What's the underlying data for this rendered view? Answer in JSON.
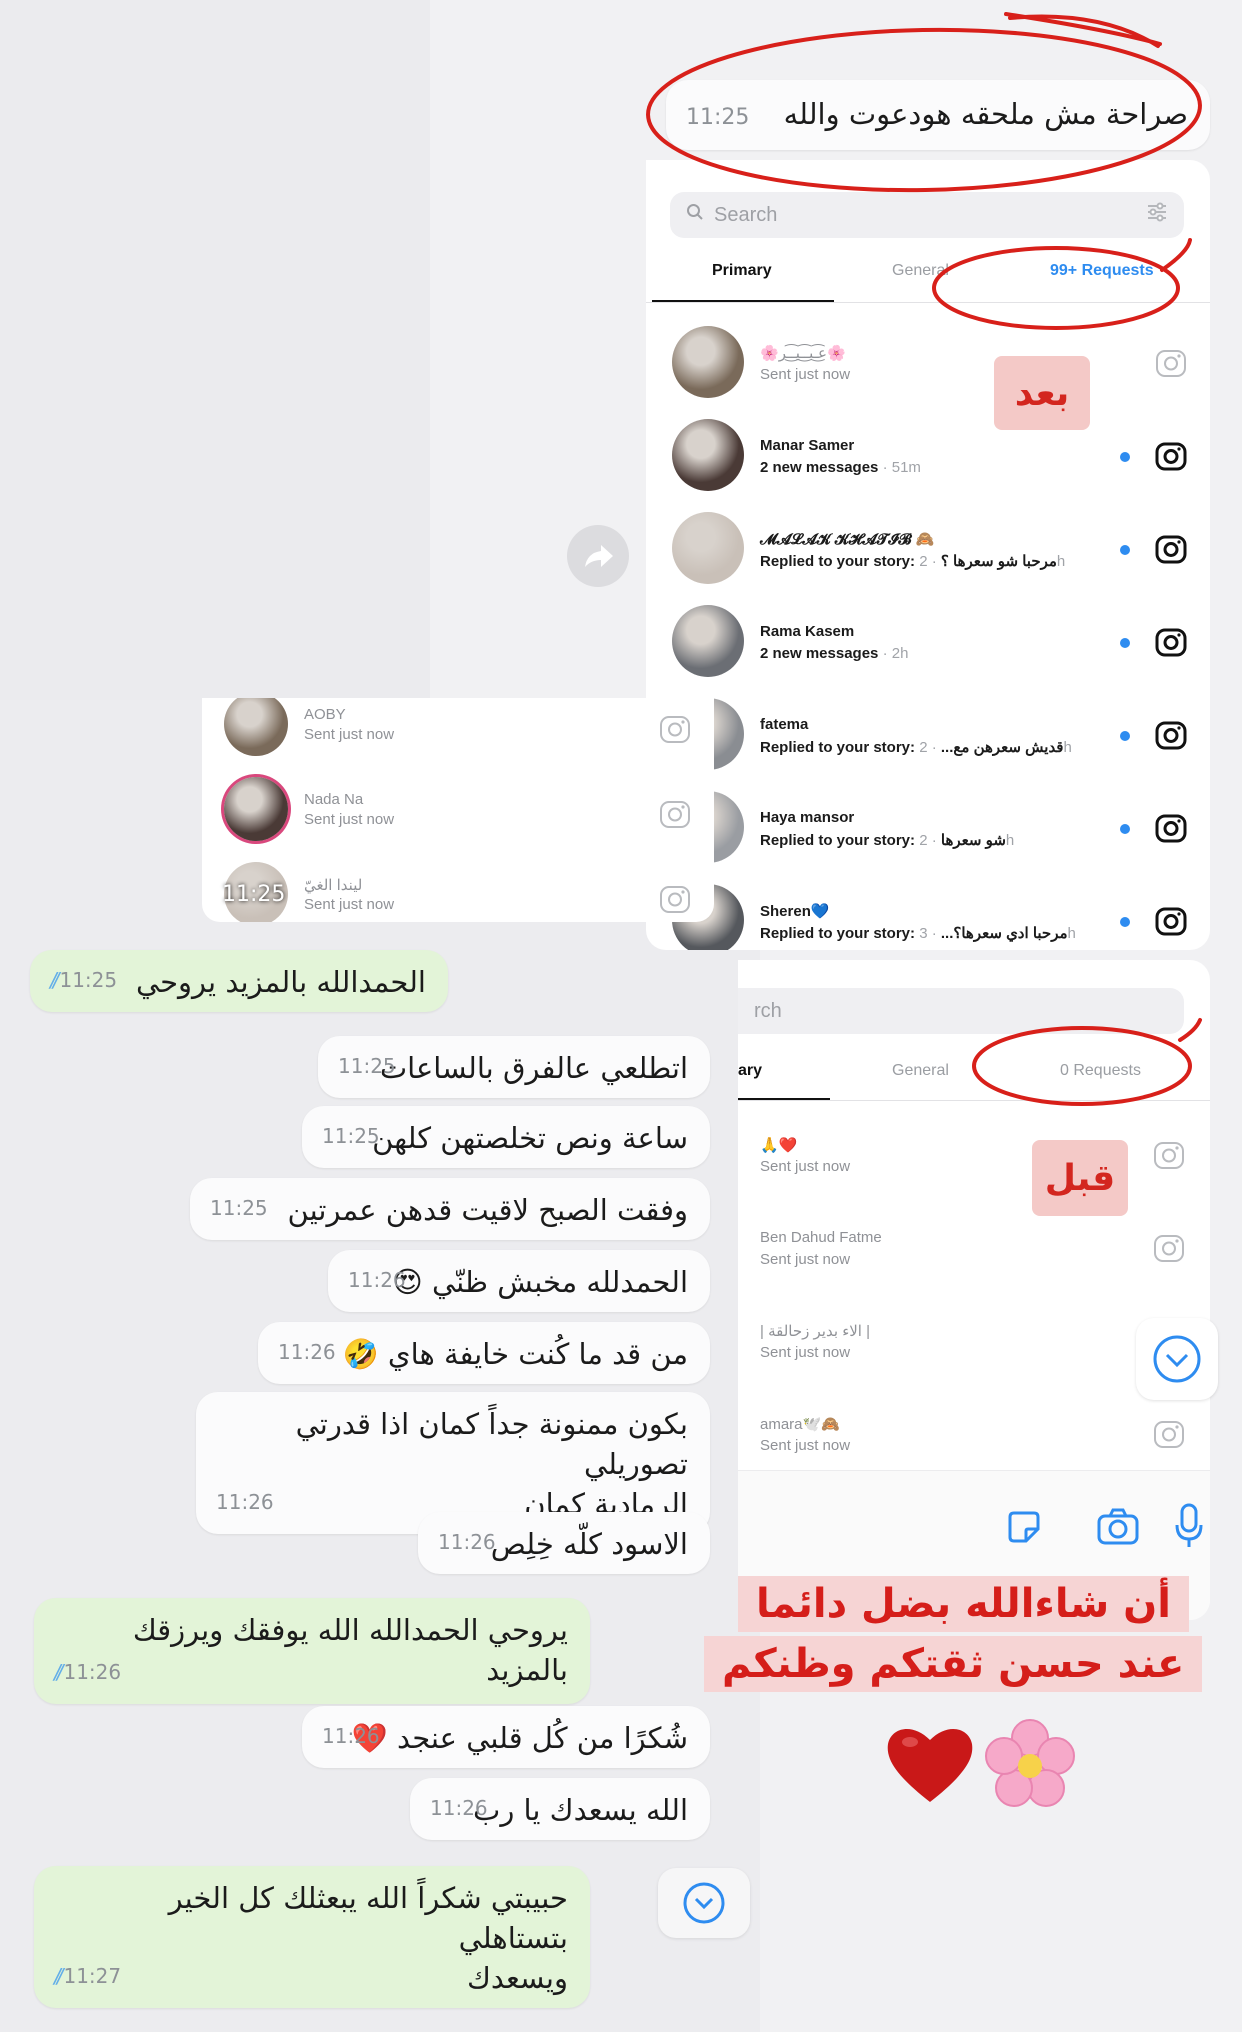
{
  "top_bubble": {
    "text": "صراحة مش ملحقه هودعوت والله",
    "time": "11:25"
  },
  "after_panel": {
    "search_placeholder": "Search",
    "tabs": {
      "primary": "Primary",
      "general": "General",
      "requests": "99+ Requests"
    },
    "label": "بعد",
    "rows": [
      {
        "name": "🌸ع͜͡ـبـ͜͡ـيـ͜͡ـر🌸",
        "sub": "Sent just now",
        "ago": "",
        "unread": false
      },
      {
        "name": "Manar Samer",
        "sub": "2 new messages",
        "ago": "· 51m",
        "unread": true
      },
      {
        "name": "𝓜𝓐𝓛𝓐𝓚 𝓚𝓗𝓐𝓣𝓘𝓑 🙈",
        "sub": "Replied to your story: مرحبا شو سعرها ؟",
        "ago": "· 2h",
        "unread": true
      },
      {
        "name": "Rama Kasem",
        "sub": "2 new messages",
        "ago": "· 2h",
        "unread": true
      },
      {
        "name": "fatema",
        "sub": "Replied to your story: قديش سعرهن مع...",
        "ago": "· 2h",
        "unread": true
      },
      {
        "name": "Haya mansor",
        "sub": "Replied to your story: شو سعرها",
        "ago": "· 2h",
        "unread": true
      },
      {
        "name": "Sheren💙",
        "sub": "Replied to your story: مرحبا ادي سعرها؟...",
        "ago": "· 3h",
        "unread": true
      }
    ]
  },
  "before_panel": {
    "search_placeholder": "rch",
    "tabs": {
      "primary": "ary",
      "general": "General",
      "requests": "0 Requests"
    },
    "label": "قبل",
    "rows": [
      {
        "name": "🙏❤️",
        "sub": "Sent just now"
      },
      {
        "name": "Ben Dahud Fatme",
        "sub": "Sent just now"
      },
      {
        "name": "| الاء بدير زحالقة |",
        "sub": "Sent just now"
      },
      {
        "name": "amara🕊️🙈",
        "sub": "Sent just now"
      }
    ]
  },
  "small_panel": {
    "rows": [
      {
        "name": "AOBY",
        "sub": "Sent just now"
      },
      {
        "name": "Nada Na",
        "sub": "Sent just now"
      },
      {
        "name": "ليندا الغيّ",
        "sub": "Sent just now"
      }
    ],
    "time_overlay": "11:25"
  },
  "chat": [
    {
      "type": "sent",
      "text": "الحمدالله بالمزيد يروحي",
      "time": "11:25"
    },
    {
      "type": "recv",
      "text": "اتطلعي عالفرق بالساعات",
      "time": "11:25"
    },
    {
      "type": "recv",
      "text": "ساعة ونص تخلصتهن كلهن",
      "time": "11:25"
    },
    {
      "type": "recv",
      "text": "وفقت الصبح لاقيت قدهن عمرتين",
      "time": "11:25"
    },
    {
      "type": "recv",
      "text": "الحمدلله مخبش ظنّي 😍",
      "time": "11:26"
    },
    {
      "type": "recv",
      "text": "من قد ما كُنت خايفة هاي 🤣",
      "time": "11:26"
    },
    {
      "type": "recv",
      "text": "بكون ممنونة جداً كمان اذا قدرتي تصوريلي\nالرمادية كمان",
      "time": "11:26"
    },
    {
      "type": "recv",
      "text": "الاسود كلّه خِلِص",
      "time": "11:26"
    },
    {
      "type": "sent",
      "text": "يروحي الحمدالله الله يوفقك ويرزقك بالمزيد",
      "time": "11:26"
    },
    {
      "type": "recv",
      "text": "شُكرًا من كُل قلبي عنجد ❤️",
      "time": "11:26"
    },
    {
      "type": "recv",
      "text": "الله يسعدك يا رب",
      "time": "11:26"
    },
    {
      "type": "sent",
      "text": "حبيبتي شكراً الله يبعثلك كل الخير بتستاهلي\nويسعدك",
      "time": "11:27"
    }
  ],
  "annotation": {
    "line1": "أن شاءالله بضل دائما",
    "line2": "عند حسن ثقتكم وظنكم",
    "emojis": "❤️🌸"
  },
  "colors": {
    "sent_bubble": "#e3f4d8",
    "recv_bubble": "#fbfbfc",
    "instagram_blue": "#2e8cf0",
    "annotation_red": "#d51e1a",
    "annotation_bg": "#f6d4d4",
    "circle_red": "#d8201a"
  }
}
